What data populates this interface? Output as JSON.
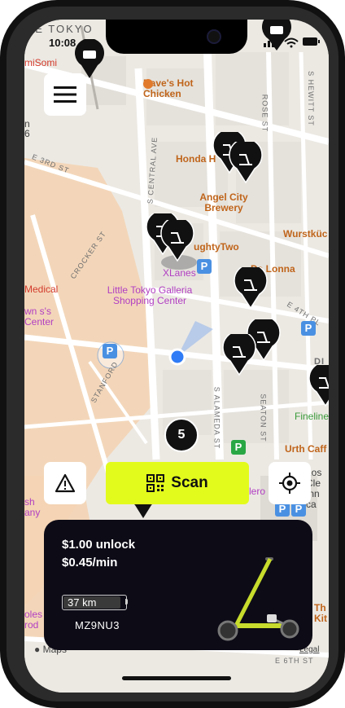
{
  "status_bar": {
    "time": "10:08"
  },
  "map": {
    "top_label": "LE TOKYO",
    "poi_labels": {
      "dave": "Dave's Hot Chicken",
      "honda": "Honda H",
      "angel": "Angel City Brewery",
      "wurst": "Wurstküc",
      "naughty": "ughtyTwo",
      "dalonna": "Da Lonna",
      "xlanes": "XLanes",
      "tokyo_galleria": "Little Tokyo Galleria Shopping Center",
      "medical": "Medical",
      "town": "wn s's Center",
      "somi": "miSomi",
      "fineline": "Fineline",
      "urth": "Urth Caff",
      "los": "Los Cle Inn ca",
      "ero": "lero",
      "sh_any": "sh any",
      "th_kit": "Th Kit",
      "olea": "oles rod",
      "left_edge": "n 6"
    },
    "street_labels": {
      "e3rd": "E 3RD ST",
      "crocker": "CROCKER ST",
      "central": "S CENTRAL AVE",
      "rose": "ROSE ST",
      "hewitt": "S HEWITT ST",
      "alameda": "S ALAMEDA ST",
      "seaton": "SEATON ST",
      "e4th": "E 4TH PL",
      "stanford": "STANFORD",
      "e6th": "E 6TH ST",
      "di": "DI"
    },
    "cluster_count": "5",
    "attribution": "Maps",
    "legal": "Legal"
  },
  "controls": {
    "scan_label": "Scan"
  },
  "card": {
    "unlock_price": "$1.00 unlock",
    "minute_price": "$0.45/min",
    "range": "37 km",
    "range_level": 0.95,
    "vehicle_id": "MZ9NU3"
  },
  "colors": {
    "accent": "#e3fb1c",
    "card_bg": "#0d0b16",
    "location_dot": "#2f7cf6",
    "parking": "#4a90e2",
    "parking_green": "#29a745"
  }
}
